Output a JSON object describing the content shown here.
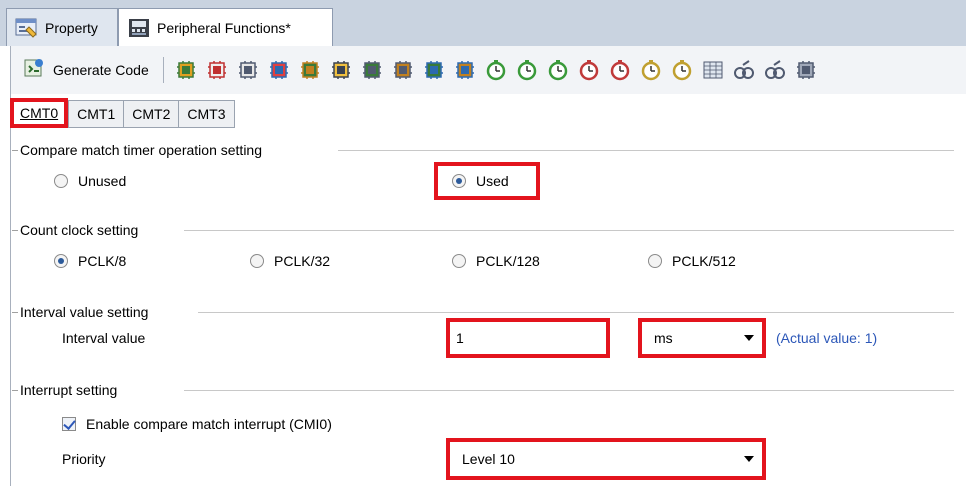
{
  "doc_tabs": [
    {
      "label": "Property",
      "icon": "property-icon"
    },
    {
      "label": "Peripheral Functions*",
      "icon": "peripheral-functions-icon"
    }
  ],
  "toolbar": {
    "generate_label": "Generate Code",
    "icons": [
      "clock-generator-icon",
      "system-icon",
      "bus-icon",
      "event-link-icon",
      "interrupt-icon",
      "io-port-icon",
      "dtc-icon",
      "dmac-icon",
      "mtu-icon",
      "tpu-icon",
      "timer-icon",
      "timer-icon",
      "timer-icon",
      "timer-icon",
      "timer-icon",
      "timer-icon",
      "timer-icon",
      "rtc-icon",
      "watchdog-icon",
      "watchdog-icon",
      "serial-icon"
    ]
  },
  "cmt_tabs": [
    "CMT0",
    "CMT1",
    "CMT2",
    "CMT3"
  ],
  "groups": {
    "operation": {
      "title": "Compare match timer operation setting",
      "options": [
        {
          "label": "Unused",
          "selected": false
        },
        {
          "label": "Used",
          "selected": true
        }
      ]
    },
    "clock": {
      "title": "Count clock setting",
      "options": [
        {
          "label": "PCLK/8",
          "selected": true
        },
        {
          "label": "PCLK/32",
          "selected": false
        },
        {
          "label": "PCLK/128",
          "selected": false
        },
        {
          "label": "PCLK/512",
          "selected": false
        }
      ]
    },
    "interval": {
      "title": "Interval value setting",
      "label": "Interval value",
      "value": "1",
      "unit": "ms",
      "actual": "(Actual value: 1)"
    },
    "interrupt": {
      "title": "Interrupt setting",
      "enable_label": "Enable compare match interrupt (CMI0)",
      "enable_checked": true,
      "priority_label": "Priority",
      "priority_value": "Level 10"
    }
  },
  "colors": {
    "highlight": "#e3141d",
    "link": "#2c57b8"
  }
}
